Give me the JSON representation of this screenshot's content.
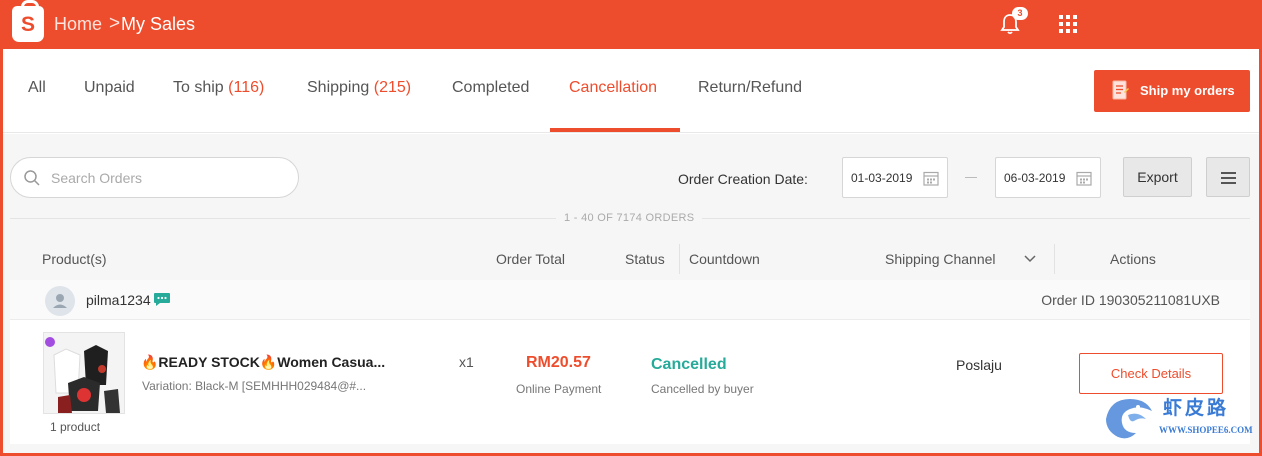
{
  "header": {
    "logo_letter": "S",
    "breadcrumb_home": "Home",
    "breadcrumb_sep": ">",
    "breadcrumb_current": "My Sales",
    "notification_count": "3",
    "brand_color": "#ee4d2d"
  },
  "tabs": [
    {
      "label": "All",
      "count": ""
    },
    {
      "label": "Unpaid",
      "count": ""
    },
    {
      "label": "To ship",
      "count": "(116)"
    },
    {
      "label": "Shipping",
      "count": "(215)"
    },
    {
      "label": "Completed",
      "count": ""
    },
    {
      "label": "Cancellation",
      "count": ""
    },
    {
      "label": "Return/Refund",
      "count": ""
    }
  ],
  "active_tab": "Cancellation",
  "toolbar": {
    "ship_button_label": "Ship my orders",
    "search_placeholder": "Search Orders",
    "date_label": "Order Creation Date:",
    "date_from": "01-03-2019",
    "date_to": "06-03-2019",
    "export_label": "Export",
    "orders_summary": "1 - 40 OF 7174 ORDERS"
  },
  "table": {
    "columns": [
      "Product(s)",
      "Order Total",
      "Status",
      "Countdown",
      "Shipping Channel",
      "Actions"
    ]
  },
  "order": {
    "username": "pilma1234",
    "order_id": "Order ID 190305211081UXB",
    "product_name": "🔥READY STOCK🔥Women Casua...",
    "variation": "Variation: Black-M [SEMHHH029484@#...",
    "product_count": "1 product",
    "quantity": "x1",
    "total": "RM20.57",
    "payment_method": "Online Payment",
    "status": "Cancelled",
    "status_detail": "Cancelled by buyer",
    "shipping_channel": "Poslaju",
    "action_label": "Check Details",
    "status_color": "#26aa99"
  },
  "watermark": {
    "name": "虾皮路",
    "url": "WWW.SHOPEE6.COM"
  }
}
